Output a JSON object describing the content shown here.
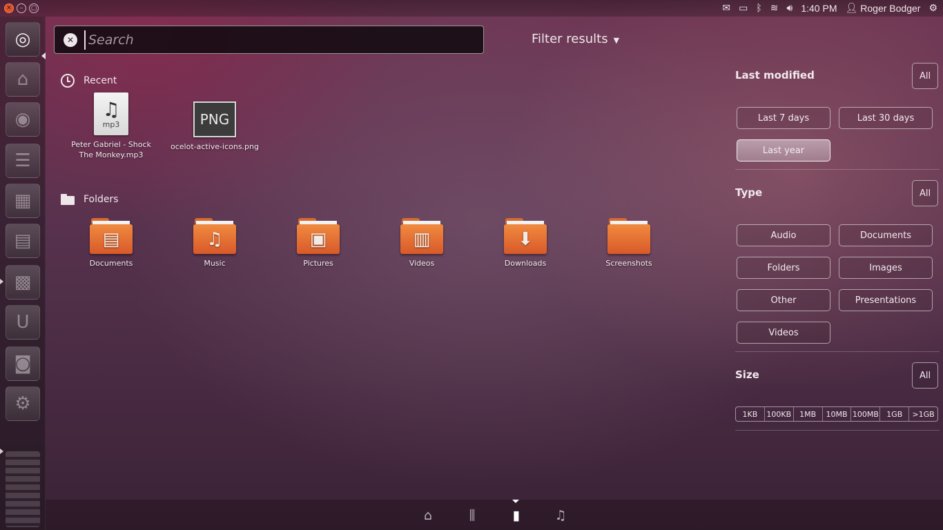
{
  "top_panel": {
    "time": "1:40 PM",
    "user_name": "Roger Bodger",
    "indicators": [
      "mail-icon",
      "battery-icon",
      "bluetooth-icon",
      "wifi-icon",
      "volume-icon"
    ]
  },
  "search": {
    "placeholder": "Search",
    "value": ""
  },
  "filter_results_label": "Filter results",
  "recent": {
    "heading": "Recent",
    "items": [
      {
        "label_line1": "Peter Gabriel - Shock",
        "label_line2": "The Monkey.mp3",
        "badge": "mp3",
        "icon": "music-note-icon"
      },
      {
        "label_line1": "ocelot-active-icons.png",
        "label_line2": "",
        "badge": "PNG",
        "icon": "png-file-icon"
      }
    ]
  },
  "folders": {
    "heading": "Folders",
    "items": [
      {
        "label": "Documents",
        "emblem": "document-emblem-icon"
      },
      {
        "label": "Music",
        "emblem": "music-emblem-icon"
      },
      {
        "label": "Pictures",
        "emblem": "pictures-emblem-icon"
      },
      {
        "label": "Videos",
        "emblem": "film-emblem-icon"
      },
      {
        "label": "Downloads",
        "emblem": "download-arrow-icon"
      },
      {
        "label": "Screenshots",
        "emblem": ""
      }
    ]
  },
  "filters": {
    "last_modified": {
      "title": "Last modified",
      "all_label": "All",
      "options": [
        "Last 7 days",
        "Last 30 days",
        "Last year"
      ],
      "selected": "Last year"
    },
    "type": {
      "title": "Type",
      "all_label": "All",
      "options": [
        "Audio",
        "Documents",
        "Folders",
        "Images",
        "Other",
        "Presentations",
        "Videos"
      ]
    },
    "size": {
      "title": "Size",
      "all_label": "All",
      "options": [
        "1KB",
        "100KB",
        "1MB",
        "10MB",
        "100MB",
        "1GB",
        ">1GB"
      ]
    }
  },
  "lenses": {
    "items": [
      "home-lens-icon",
      "applications-lens-icon",
      "files-lens-icon",
      "music-lens-icon"
    ],
    "active": "files-lens-icon"
  },
  "colors": {
    "folder_orange": "#e8722f",
    "close_button": "#e05428"
  }
}
